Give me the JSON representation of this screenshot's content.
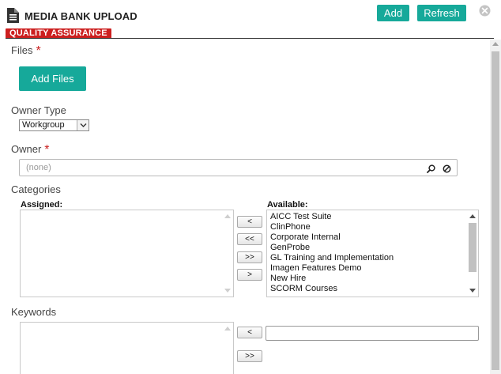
{
  "header": {
    "title": "MEDIA BANK UPLOAD",
    "add_label": "Add",
    "refresh_label": "Refresh",
    "badge": "QUALITY ASSURANCE"
  },
  "form": {
    "files": {
      "label": "Files",
      "required_mark": "*",
      "button": "Add Files"
    },
    "owner_type": {
      "label": "Owner Type",
      "selected": "Workgroup"
    },
    "owner": {
      "label": "Owner",
      "required_mark": "*",
      "value": "(none)"
    },
    "categories": {
      "label": "Categories",
      "assigned_label": "Assigned:",
      "available_label": "Available:",
      "available": [
        "AICC Test Suite",
        "ClinPhone",
        "Corporate Internal",
        "GenProbe",
        "GL Training and Implementation",
        "Imagen Features Demo",
        "New Hire",
        "SCORM Courses"
      ],
      "move_buttons": [
        "<",
        "<<",
        ">>",
        ">"
      ]
    },
    "keywords": {
      "label": "Keywords",
      "move_buttons": [
        "<",
        ">>"
      ]
    }
  },
  "colors": {
    "accent": "#16a99a",
    "badge": "#cc1f1f",
    "required": "#c91f1f"
  },
  "icons": [
    "document-icon",
    "close-circle-icon",
    "search-icon",
    "clear-icon",
    "chevron-down-icon"
  ]
}
